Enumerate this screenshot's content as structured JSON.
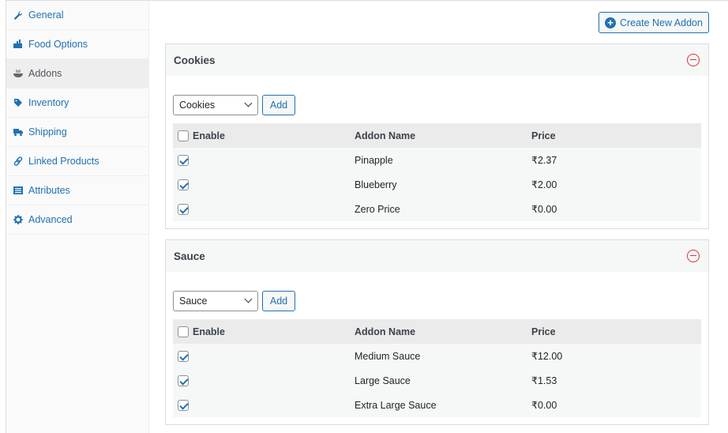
{
  "sidebar": {
    "items": [
      {
        "label": "General",
        "icon": "wrench-icon",
        "active": false
      },
      {
        "label": "Food Options",
        "icon": "food-options-icon",
        "active": false
      },
      {
        "label": "Addons",
        "icon": "bowl-icon",
        "active": true
      },
      {
        "label": "Inventory",
        "icon": "tag-icon",
        "active": false
      },
      {
        "label": "Shipping",
        "icon": "truck-icon",
        "active": false
      },
      {
        "label": "Linked Products",
        "icon": "link-icon",
        "active": false
      },
      {
        "label": "Attributes",
        "icon": "list-icon",
        "active": false
      },
      {
        "label": "Advanced",
        "icon": "gear-icon",
        "active": false
      }
    ]
  },
  "toolbar": {
    "create_label": "Create New Addon"
  },
  "colors": {
    "accent": "#2271b1",
    "danger": "#d63638"
  },
  "groups": [
    {
      "title": "Cookies",
      "select_value": "Cookies",
      "add_label": "Add",
      "headers": {
        "enable": "Enable",
        "name": "Addon Name",
        "price": "Price"
      },
      "rows": [
        {
          "name": "Pinapple",
          "price": "₹2.37",
          "enabled": true
        },
        {
          "name": "Blueberry",
          "price": "₹2.00",
          "enabled": true
        },
        {
          "name": "Zero Price",
          "price": "₹0.00",
          "enabled": true
        }
      ]
    },
    {
      "title": "Sauce",
      "select_value": "Sauce",
      "add_label": "Add",
      "headers": {
        "enable": "Enable",
        "name": "Addon Name",
        "price": "Price"
      },
      "rows": [
        {
          "name": "Medium Sauce",
          "price": "₹12.00",
          "enabled": true
        },
        {
          "name": "Large Sauce",
          "price": "₹1.53",
          "enabled": true
        },
        {
          "name": "Extra Large Sauce",
          "price": "₹0.00",
          "enabled": true
        }
      ]
    }
  ]
}
